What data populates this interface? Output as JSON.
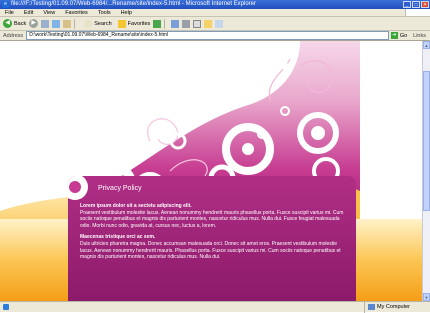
{
  "window": {
    "title": "file:///F:/Testing/01.09.07/Web-6984/...Rename/site/index-5.html - Microsoft Internet Explorer",
    "min": "_",
    "max": "□",
    "close": "✕"
  },
  "menu": [
    "File",
    "Edit",
    "View",
    "Favorites",
    "Tools",
    "Help"
  ],
  "toolbar": {
    "back": "Back",
    "search": "Search",
    "favorites": "Favorites"
  },
  "address": {
    "label": "Address",
    "value": "D:\\work\\Testing\\01.09.07\\Web-6984_Rename\\site\\index-5.html",
    "go": "Go",
    "links": "Links"
  },
  "panel": {
    "title": "Privacy Policy",
    "para1_heading": "Lorem ipsum dolor sit a sectetu adipiscing elit.",
    "para1": "Praesent vestibulum molestie lacus. Aenean nonummy hendrerit mauris phasellus porta. Fusce suscipit varius mi. Cum sociis natoque penatibus et magnis dis parturient montes, nascetur ridiculus mus. Nulla dui. Fusce feugiat malesuada odio. Morbi nunc odio, gravida at, cursus nec, luctus a, lorem.",
    "para2_heading": "Maecenas tristique orci ac sem.",
    "para2": "Duis ultricies pharetra magna. Donec accumsan malesuada orci. Donec sit amet eros. Praesent vestibulum molestie lacus. Aenean nonummy hendrerit mauris. Phasellus porta. Fusce suscipit varius mi. Cum sociis natoque penatibus et magnis dis parturient montes, nascetur ridiculus mus. Nulla dui."
  },
  "status": {
    "zone": "My Computer"
  },
  "colors": {
    "magenta": "#b02f86",
    "orange": "#f7a91e"
  }
}
